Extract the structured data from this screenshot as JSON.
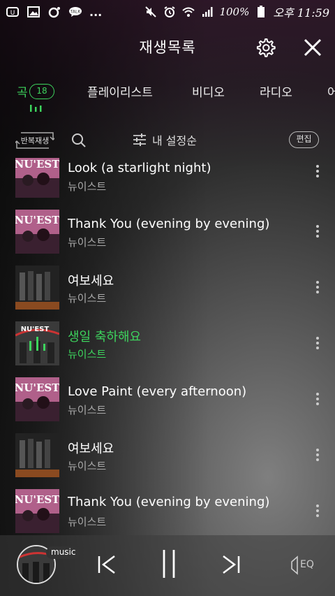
{
  "status_bar": {
    "battery": "100%",
    "time": "오후 11:59",
    "more": "..."
  },
  "header": {
    "title": "재생목록"
  },
  "tabs": [
    {
      "label": "곡",
      "badge": "18",
      "active": true
    },
    {
      "label": "플레이리스트"
    },
    {
      "label": "비디오"
    },
    {
      "label": "라디오"
    },
    {
      "label": "어"
    }
  ],
  "controls": {
    "repeat_label": "반복재생",
    "sort_label": "내 설정순",
    "edit_label": "편집"
  },
  "songs": [
    {
      "title": "Look (a starlight night)",
      "artist": "뉴이스트",
      "cover": "nuest-pink"
    },
    {
      "title": "Thank You (evening by evening)",
      "artist": "뉴이스트",
      "cover": "nuest-pink"
    },
    {
      "title": "여보세요",
      "artist": "뉴이스트",
      "cover": "group-dark"
    },
    {
      "title": "생일 축하해요",
      "artist": "뉴이스트",
      "cover": "nuest-action",
      "playing": true
    },
    {
      "title": "Love Paint (every afternoon)",
      "artist": "뉴이스트",
      "cover": "nuest-pink"
    },
    {
      "title": "여보세요",
      "artist": "뉴이스트",
      "cover": "group-dark"
    },
    {
      "title": "Thank You (evening by evening)",
      "artist": "뉴이스트",
      "cover": "nuest-pink"
    }
  ],
  "player": {
    "tag": "music",
    "eq_label": "EQ"
  },
  "colors": {
    "accent": "#3dd35d",
    "text": "#ffffff",
    "subtext": "#aaaaaa"
  }
}
